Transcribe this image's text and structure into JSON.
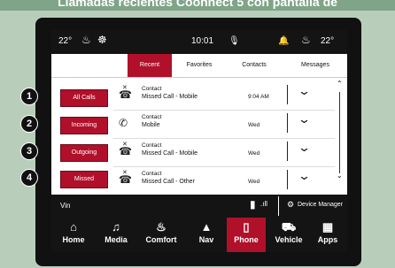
{
  "caption": "Llamadas recientes Coonnect 5 con pantalla de",
  "status": {
    "temp_left": "22°",
    "time": "10:01",
    "temp_right": "22°"
  },
  "tabs": [
    "Recent",
    "Favorites",
    "Contacts",
    "Messages"
  ],
  "left_buttons": [
    "All Calls",
    "Incoming",
    "Outgoing",
    "Missed"
  ],
  "callouts": [
    "1",
    "2",
    "3",
    "4"
  ],
  "rows": [
    {
      "name": "Contact",
      "sub": "Missed Call - Mobile",
      "time": "9:04 AM"
    },
    {
      "name": "Contact",
      "sub": "Mobile",
      "time": "Wed"
    },
    {
      "name": "Contact",
      "sub": "Missed Call - Mobile",
      "time": "Wed"
    },
    {
      "name": "Contact",
      "sub": "Missed Call - Other",
      "time": "Wed"
    }
  ],
  "bottom": {
    "device": "Vin",
    "manager": "Device Manager"
  },
  "nav": [
    "Home",
    "Media",
    "Comfort",
    "Nav",
    "Phone",
    "Vehicle",
    "Apps"
  ]
}
